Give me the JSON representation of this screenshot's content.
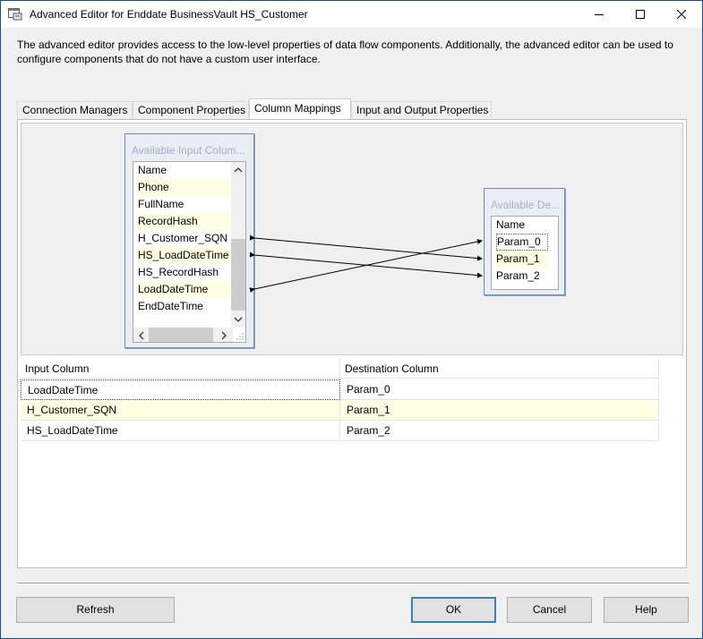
{
  "window": {
    "title": "Advanced Editor for Enddate BusinessVault HS_Customer"
  },
  "description": "The advanced editor provides access to the low-level properties of data flow components. Additionally, the advanced editor can be used to configure components that do not have a custom user interface.",
  "tabs": [
    {
      "label": "Connection Managers"
    },
    {
      "label": "Component Properties"
    },
    {
      "label": "Column Mappings",
      "active": true
    },
    {
      "label": "Input and Output Properties"
    }
  ],
  "input_box": {
    "title": "Available Input Colum...",
    "header": "Name",
    "columns": [
      "Phone",
      "FullName",
      "RecordHash",
      "H_Customer_SQN",
      "HS_LoadDateTime",
      "HS_RecordHash",
      "LoadDateTime",
      "EndDateTime"
    ]
  },
  "dest_box": {
    "title": "Available De...",
    "header": "Name",
    "columns": [
      "Param_0",
      "Param_1",
      "Param_2"
    ]
  },
  "grid": {
    "headers": [
      "Input Column",
      "Destination Column"
    ],
    "rows": [
      {
        "input": "LoadDateTime",
        "destination": "Param_0"
      },
      {
        "input": "H_Customer_SQN",
        "destination": "Param_1"
      },
      {
        "input": "HS_LoadDateTime",
        "destination": "Param_2"
      }
    ]
  },
  "buttons": {
    "refresh": "Refresh",
    "ok": "OK",
    "cancel": "Cancel",
    "help": "Help"
  }
}
